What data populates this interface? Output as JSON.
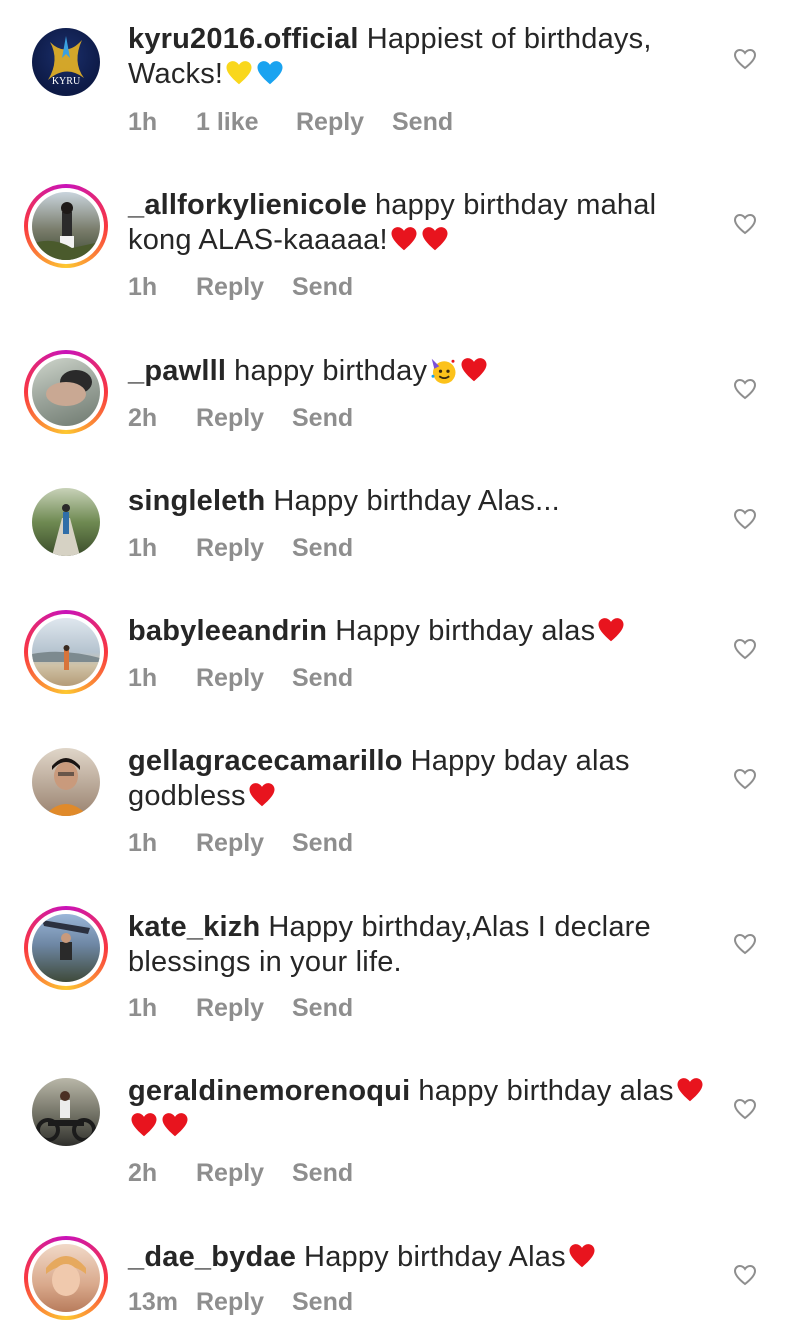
{
  "colors": {
    "text": "#262626",
    "meta": "#8e8e8e",
    "red_heart": "#e8141e",
    "yellow_heart": "#f9d71c",
    "blue_heart": "#1aa3f0",
    "story_ring": "#c913b9"
  },
  "comments": [
    {
      "username": "kyru2016.official",
      "text": "Happiest of birthdays, Wacks!",
      "emojis": [
        "yellow-heart",
        "blue-heart"
      ],
      "time": "1h",
      "likes": "1 like",
      "reply": "Reply",
      "send": "Send",
      "avatar_logo_text": "KYRU"
    },
    {
      "username": "_allforkylienicole",
      "text": "happy birthday mahal kong ALAS-kaaaaa!",
      "emojis": [
        "red-heart",
        "red-heart"
      ],
      "time": "1h",
      "reply": "Reply",
      "send": "Send"
    },
    {
      "username": "_pawlll",
      "text": "happy birthday",
      "emojis": [
        "party-face",
        "red-heart"
      ],
      "time": "2h",
      "reply": "Reply",
      "send": "Send"
    },
    {
      "username": "singleleth",
      "text": "Happy birthday Alas...",
      "emojis": [],
      "time": "1h",
      "reply": "Reply",
      "send": "Send"
    },
    {
      "username": "babyleeandrin",
      "text": "Happy birthday alas",
      "emojis": [
        "red-heart"
      ],
      "time": "1h",
      "reply": "Reply",
      "send": "Send"
    },
    {
      "username": "gellagracecamarillo",
      "text": "Happy bday alas godbless",
      "emojis": [
        "red-heart"
      ],
      "time": "1h",
      "reply": "Reply",
      "send": "Send"
    },
    {
      "username": "kate_kizh",
      "text": "Happy birthday,Alas I declare blessings in your life.",
      "emojis": [],
      "time": "1h",
      "reply": "Reply",
      "send": "Send"
    },
    {
      "username": "geraldinemorenoqui",
      "text": "happy birthday alas",
      "emojis": [
        "red-heart",
        "red-heart",
        "red-heart"
      ],
      "time": "2h",
      "reply": "Reply",
      "send": "Send"
    },
    {
      "username": "_dae_bydae",
      "text": "Happy birthday Alas",
      "emojis": [
        "red-heart"
      ],
      "time": "13m",
      "reply": "Reply",
      "send": "Send"
    }
  ]
}
